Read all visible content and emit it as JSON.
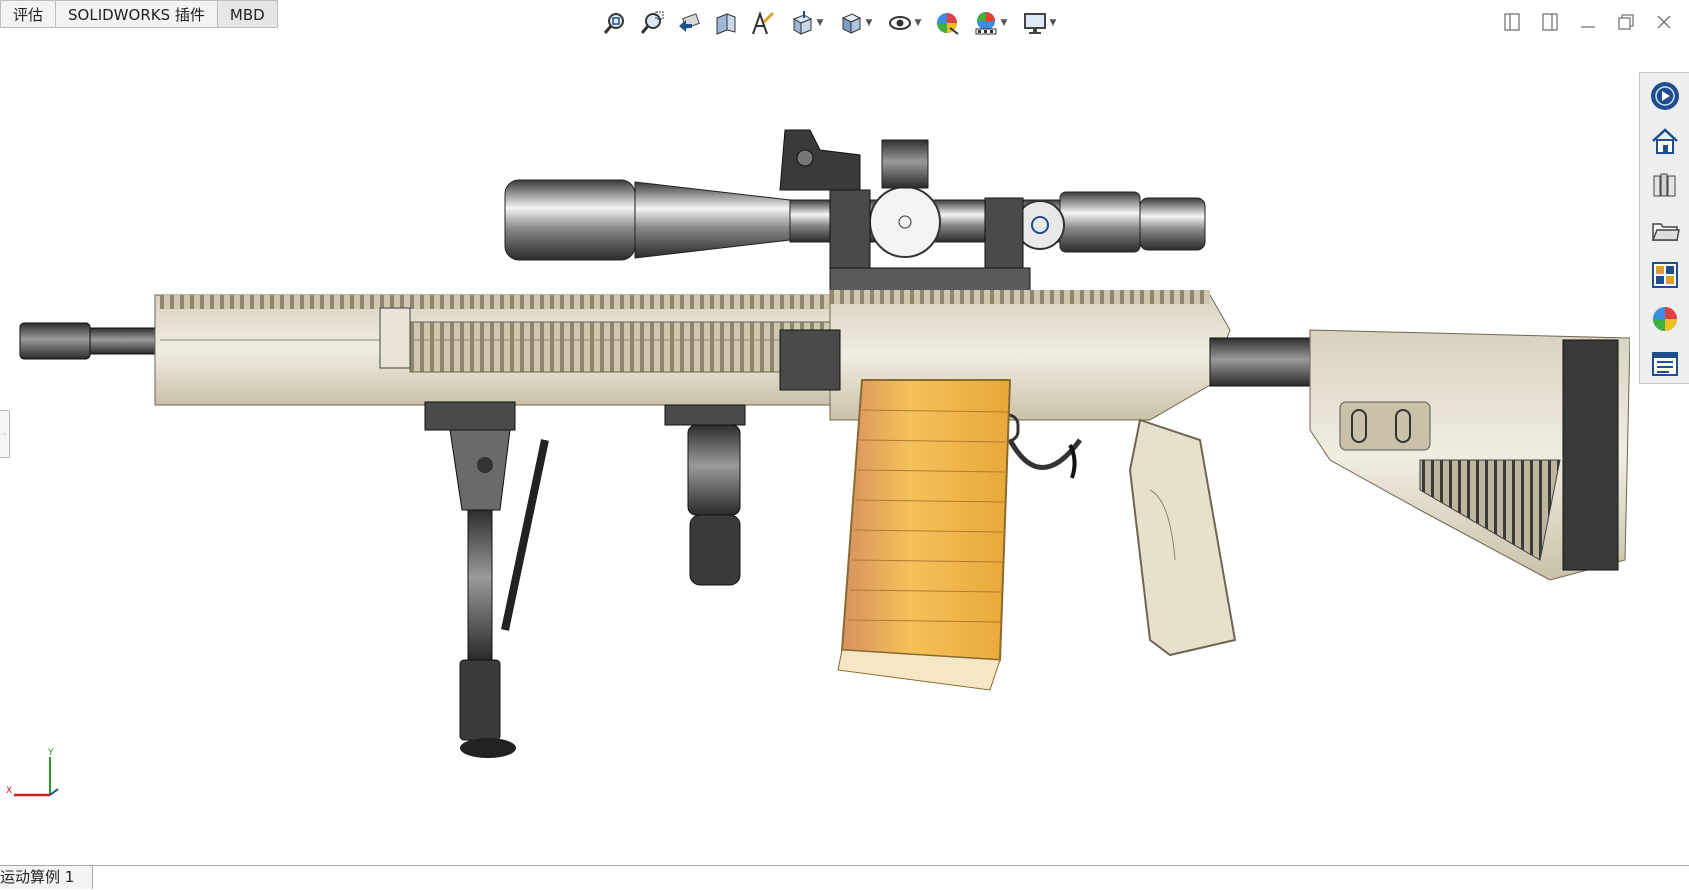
{
  "tabs": [
    "评估",
    "SOLIDWORKS 插件",
    "MBD"
  ],
  "hud_icons": [
    "zoom-to-fit-icon",
    "zoom-to-area-icon",
    "previous-view-icon",
    "section-view-icon",
    "dynamic-annotation-icon",
    "view-orientation-icon",
    "display-style-icon",
    "hide-show-items-icon",
    "edit-appearance-icon",
    "apply-scene-icon",
    "view-settings-icon"
  ],
  "window_controls": [
    "tile-left-icon",
    "tile-right-icon",
    "minimize-icon",
    "restore-icon",
    "close-icon"
  ],
  "taskpane_icons": [
    "solidworks-resources-icon",
    "home-icon",
    "design-library-icon",
    "file-explorer-icon",
    "view-palette-icon",
    "appearances-icon",
    "custom-properties-icon"
  ],
  "triad": {
    "y_label": "Y",
    "x_label": "X"
  },
  "motion_tab": "运动算例 1",
  "colors": {
    "accent_blue": "#1f4e8c",
    "magazine": "#e8b44a",
    "scope": "#6a6a6a",
    "body": "#e9e4d6"
  }
}
